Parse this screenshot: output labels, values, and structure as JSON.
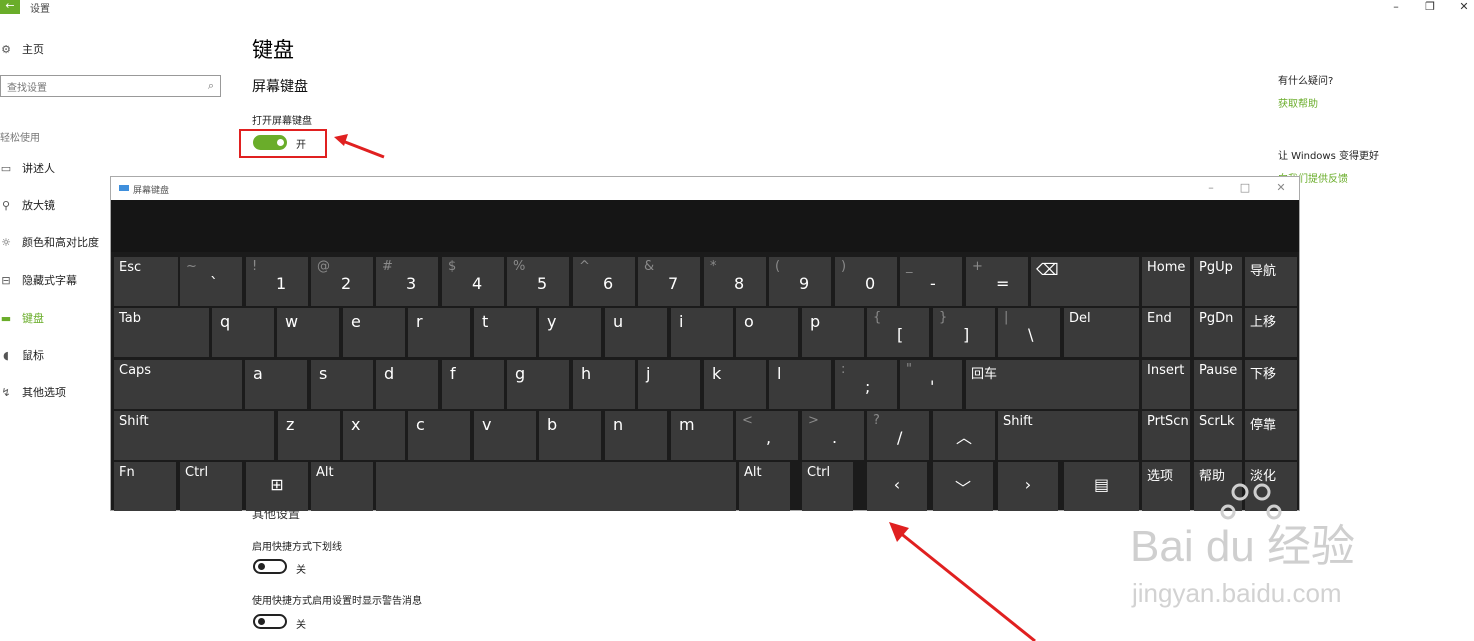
{
  "window": {
    "back_icon": "back-arrow-icon",
    "title": "设置",
    "minimize": "–",
    "restore": "❐",
    "close": "✕"
  },
  "sidebar": {
    "home_label": "主页",
    "search_placeholder": "查找设置",
    "section": "轻松使用",
    "items": [
      {
        "label": "讲述人",
        "icon": "narrator-icon",
        "active": false
      },
      {
        "label": "放大镜",
        "icon": "magnifier-icon",
        "active": false
      },
      {
        "label": "颜色和高对比度",
        "icon": "contrast-icon",
        "active": false
      },
      {
        "label": "隐藏式字幕",
        "icon": "captions-icon",
        "active": false
      },
      {
        "label": "键盘",
        "icon": "keyboard-icon",
        "active": true
      },
      {
        "label": "鼠标",
        "icon": "mouse-icon",
        "active": false
      },
      {
        "label": "其他选项",
        "icon": "other-options-icon",
        "active": false
      }
    ]
  },
  "main": {
    "title": "键盘",
    "section_osk": "屏幕键盘",
    "osk_setting_label": "打开屏幕键盘",
    "osk_toggle_state": "开",
    "other_settings_heading": "其他设置",
    "underline_label": "启用快捷方式下划线",
    "underline_state": "关",
    "warning_label": "使用快捷方式启用设置时显示警告消息",
    "warning_state": "关"
  },
  "help": {
    "question": "有什么疑问?",
    "get_help": "获取帮助",
    "improve": "让 Windows 变得更好",
    "feedback": "向我们提供反馈"
  },
  "osk": {
    "title": "屏幕键盘",
    "minimize": "–",
    "maximize": "□",
    "close": "✕",
    "rows": [
      [
        "Esc",
        "~ `",
        "! 1",
        "@ 2",
        "# 3",
        "$ 4",
        "% 5",
        "^ 6",
        "& 7",
        "* 8",
        "( 9",
        ") 0",
        "_ -",
        "+ =",
        "backspace-icon",
        "Home",
        "PgUp",
        "导航"
      ],
      [
        "Tab",
        "q",
        "w",
        "e",
        "r",
        "t",
        "y",
        "u",
        "i",
        "o",
        "p",
        "{ [",
        "} ]",
        "| \\",
        "Del",
        "End",
        "PgDn",
        "上移"
      ],
      [
        "Caps",
        "a",
        "s",
        "d",
        "f",
        "g",
        "h",
        "j",
        "k",
        "l",
        ": ;",
        "\" '",
        "回车",
        "Insert",
        "Pause",
        "下移"
      ],
      [
        "Shift",
        "z",
        "x",
        "c",
        "v",
        "b",
        "n",
        "m",
        "< ,",
        "> .",
        "? /",
        "up-arrow-icon",
        "Shift",
        "PrtScn",
        "ScrLk",
        "停靠"
      ],
      [
        "Fn",
        "Ctrl",
        "windows-icon",
        "Alt",
        "space",
        "Alt",
        "Ctrl",
        "left-arrow-icon",
        "down-arrow-icon",
        "right-arrow-icon",
        "menu-icon",
        "选项",
        "帮助",
        "淡化"
      ]
    ]
  },
  "watermark": {
    "brand": "Bai du 经验",
    "url": "jingyan.baidu.com"
  },
  "colors": {
    "accent": "#6aad2a",
    "highlight": "#e02020",
    "osk_bg": "#1b1b1b",
    "key": "#3a3a3a"
  }
}
